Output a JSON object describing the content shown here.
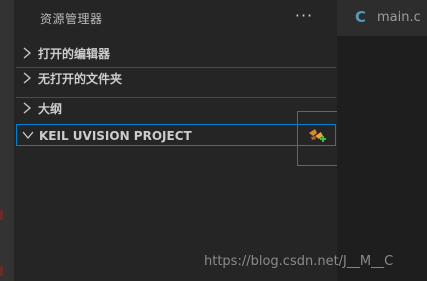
{
  "sidebar": {
    "title": "资源管理器",
    "more_label": "···",
    "sections": [
      {
        "label": "打开的编辑器"
      },
      {
        "label": "无打开的文件夹"
      },
      {
        "label": "大纲"
      },
      {
        "label": "KEIL UVISION PROJECT"
      }
    ],
    "project_icon": "keil-uvision-add-project-icon"
  },
  "editor": {
    "tab": {
      "icon": "C",
      "label": "main.c"
    }
  },
  "watermark": "https://blog.csdn.net/J__M__C",
  "colors": {
    "sidebar_bg": "#252526",
    "editor_bg": "#1e1e1e",
    "focus_border": "#007fd4",
    "highlight_box": "#e03131",
    "c_icon": "#519aba"
  }
}
